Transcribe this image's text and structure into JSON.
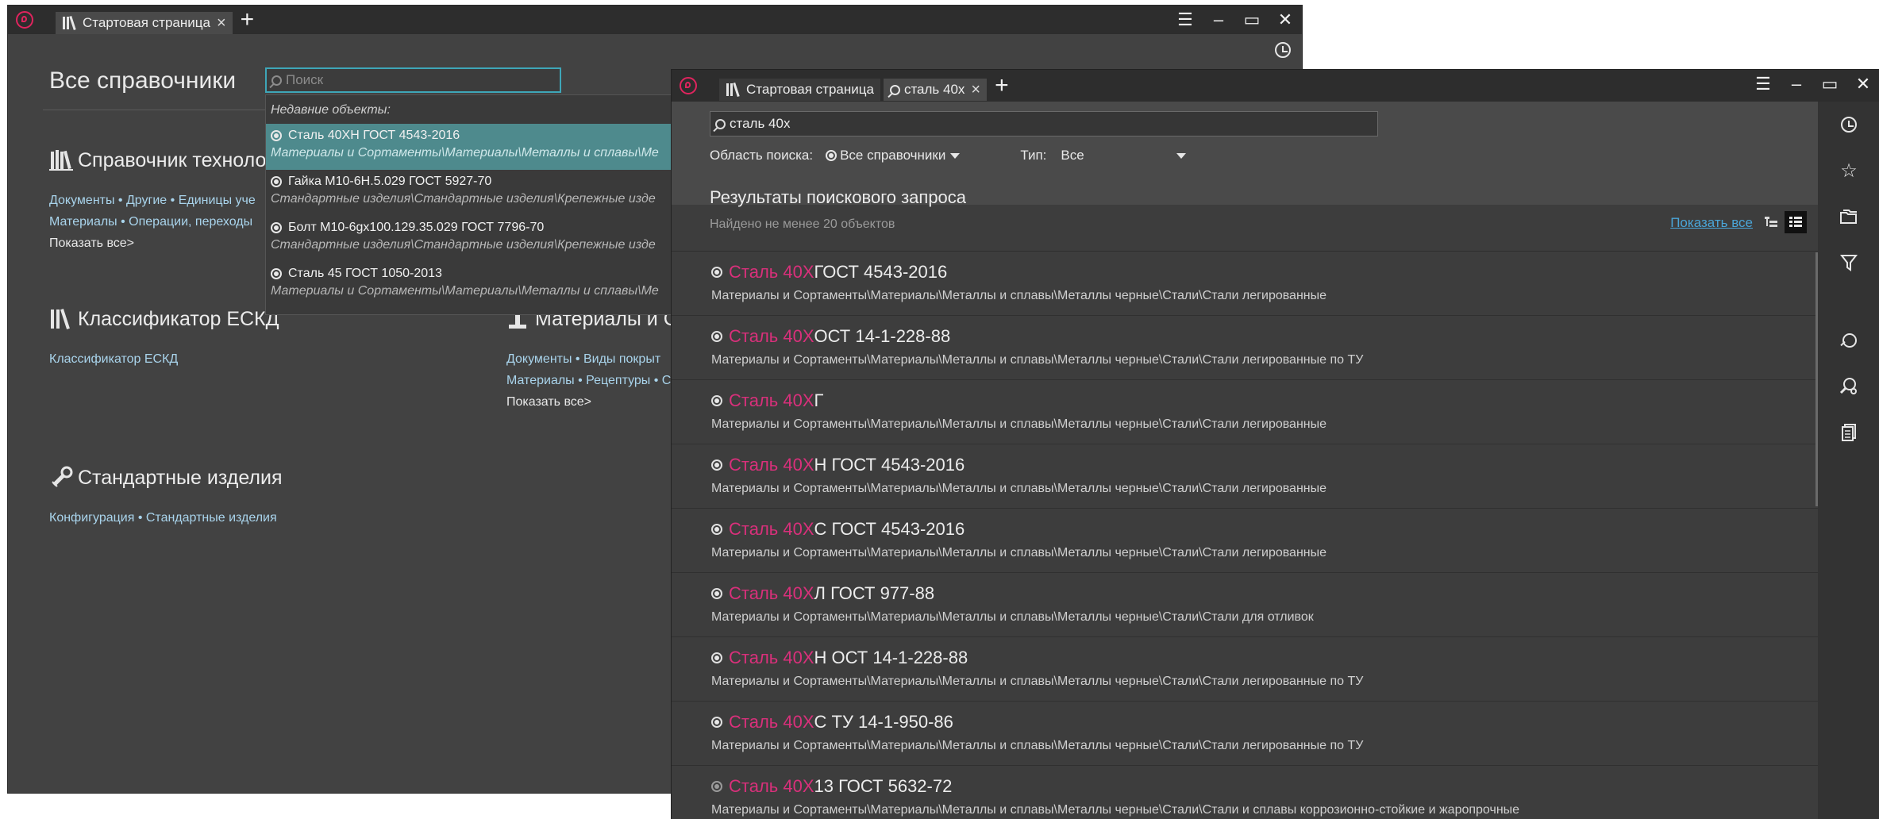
{
  "win1": {
    "tabs": [
      {
        "label": "Стартовая страница"
      }
    ],
    "page_title": "Все справочники",
    "search_placeholder": "Поиск",
    "dropdown": {
      "header": "Недавние объекты:",
      "items": [
        {
          "name": "Сталь 40ХН ГОСТ 4543-2016",
          "path": "Материалы и Сортаменты\\Материалы\\Металлы и сплавы\\Ме"
        },
        {
          "name": "Гайка М10-6Н.5.029 ГОСТ 5927-70",
          "path": "Стандартные изделия\\Стандартные изделия\\Крепежные изде"
        },
        {
          "name": "Болт М10-6gx100.129.35.029 ГОСТ 7796-70",
          "path": "Стандартные изделия\\Стандартные изделия\\Крепежные изде"
        },
        {
          "name": "Сталь 45 ГОСТ 1050-2013",
          "path": "Материалы и Сортаменты\\Материалы\\Металлы и сплавы\\Ме"
        }
      ]
    },
    "sections": {
      "tech": {
        "title": "Справочник техноло",
        "line1": "Документы • Другие • Единицы уче",
        "line2": "Материалы • Операции, переходы",
        "show_all": "Показать все>"
      },
      "eskd": {
        "title": "Классификатор ЕСКД",
        "line1": "Классификатор ЕСКД"
      },
      "materials": {
        "title": "Материалы и С",
        "line1": "Документы • Виды покрыт",
        "line2": "Материалы • Рецептуры • С",
        "show_all": "Показать все>"
      },
      "standard": {
        "title": "Стандартные изделия",
        "line1": "Конфигурация • Стандартные изделия"
      }
    }
  },
  "win2": {
    "tabs": [
      {
        "label": "Стартовая страница"
      },
      {
        "label": "сталь 40х"
      }
    ],
    "search_value": "сталь 40х",
    "scope_label": "Область поиска:",
    "scope_value": "Все справочники",
    "type_label": "Тип:",
    "type_value": "Все",
    "results_title": "Результаты поискового запроса",
    "results_count": "Найдено не менее 20 объектов",
    "show_all": "Показать все",
    "results": [
      {
        "hl": "Сталь 40Х",
        "rest": " ГОСТ 4543-2016",
        "path": "Материалы и Сортаменты\\Материалы\\Металлы и сплавы\\Металлы черные\\Стали\\Стали легированные"
      },
      {
        "hl": "Сталь 40Х",
        "rest": " ОСТ 14-1-228-88",
        "path": "Материалы и Сортаменты\\Материалы\\Металлы и сплавы\\Металлы черные\\Стали\\Стали легированные по ТУ"
      },
      {
        "hl": "Сталь 40Х",
        "rest": "Г",
        "path": "Материалы и Сортаменты\\Материалы\\Металлы и сплавы\\Металлы черные\\Стали\\Стали легированные"
      },
      {
        "hl": "Сталь 40Х",
        "rest": "Н ГОСТ 4543-2016",
        "path": "Материалы и Сортаменты\\Материалы\\Металлы и сплавы\\Металлы черные\\Стали\\Стали легированные"
      },
      {
        "hl": "Сталь 40Х",
        "rest": "С ГОСТ 4543-2016",
        "path": "Материалы и Сортаменты\\Материалы\\Металлы и сплавы\\Металлы черные\\Стали\\Стали легированные"
      },
      {
        "hl": "Сталь 40Х",
        "rest": "Л ГОСТ 977-88",
        "path": "Материалы и Сортаменты\\Материалы\\Металлы и сплавы\\Металлы черные\\Стали\\Стали для отливок"
      },
      {
        "hl": "Сталь 40Х",
        "rest": "Н ОСТ 14-1-228-88",
        "path": "Материалы и Сортаменты\\Материалы\\Металлы и сплавы\\Металлы черные\\Стали\\Стали легированные по ТУ"
      },
      {
        "hl": "Сталь 40Х",
        "rest": "С ТУ 14-1-950-86",
        "path": "Материалы и Сортаменты\\Материалы\\Металлы и сплавы\\Металлы черные\\Стали\\Стали легированные по ТУ"
      },
      {
        "hl": "Сталь 40Х",
        "rest": "13 ГОСТ 5632-72",
        "path": "Материалы и Сортаменты\\Материалы\\Металлы и сплавы\\Металлы черные\\Стали\\Стали и сплавы коррозионно-стойкие и жаропрочные"
      }
    ]
  },
  "colors": {
    "accent": "#e0245e",
    "highlight": "#d9307b",
    "selection": "#4e8a8d",
    "link": "#4aa5d8"
  }
}
